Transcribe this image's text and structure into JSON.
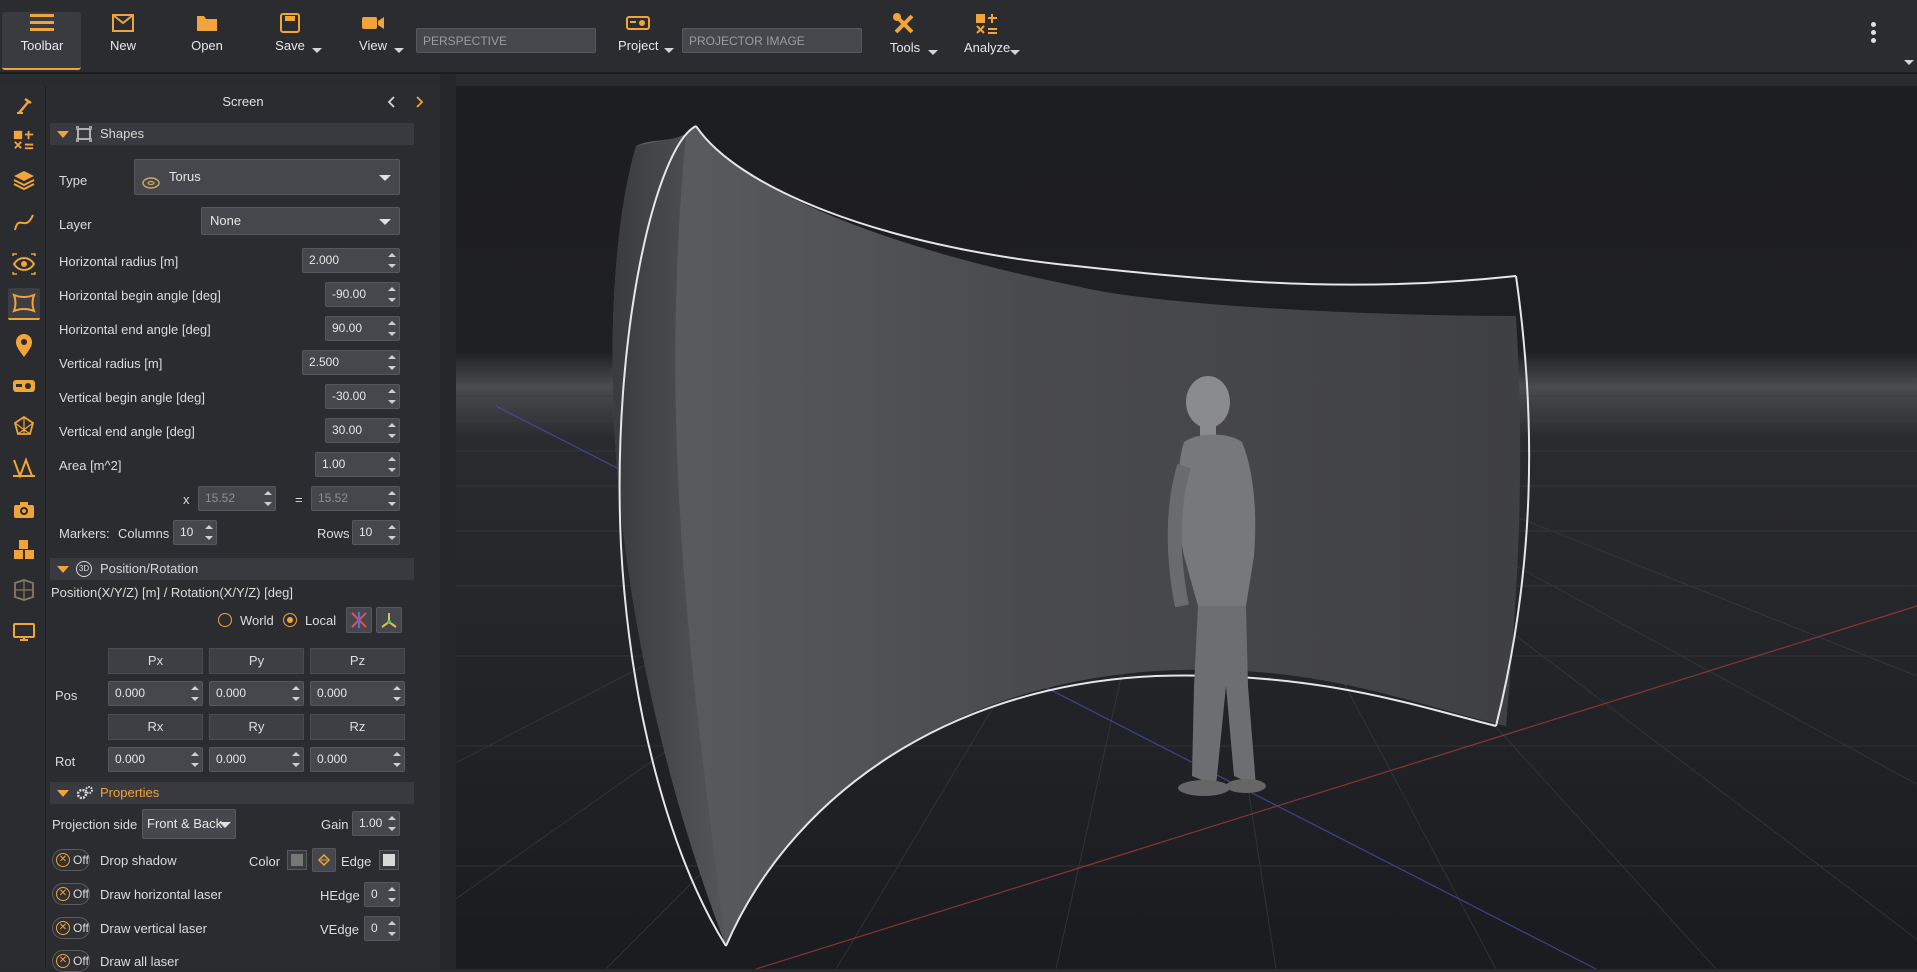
{
  "toolbar": {
    "items": [
      {
        "label": "Toolbar"
      },
      {
        "label": "New"
      },
      {
        "label": "Open"
      },
      {
        "label": "Save"
      },
      {
        "label": "View"
      },
      {
        "label": "Project"
      },
      {
        "label": "Tools"
      },
      {
        "label": "Analyze"
      }
    ],
    "perspective_field": "PERSPECTIVE",
    "projector_field": "PROJECTOR IMAGE"
  },
  "panel": {
    "title": "Screen",
    "shapes": {
      "header": "Shapes",
      "type_label": "Type",
      "type_value": "Torus",
      "layer_label": "Layer",
      "layer_value": "None",
      "fields": [
        {
          "label": "Horizontal radius  [m]",
          "value": "2.000"
        },
        {
          "label": "Horizontal begin angle [deg]",
          "value": "-90.00"
        },
        {
          "label": "Horizontal end angle [deg]",
          "value": "90.00"
        },
        {
          "label": "Vertical radius  [m]",
          "value": "2.500"
        },
        {
          "label": "Vertical begin angle [deg]",
          "value": "-30.00"
        },
        {
          "label": "Vertical end angle [deg]",
          "value": "30.00"
        },
        {
          "label": "Area  [m^2]",
          "value": "1.00"
        }
      ],
      "x_label": "x",
      "eq_label": "=",
      "dim_a": "15.52",
      "dim_b": "15.52",
      "markers_label": "Markers:",
      "columns_label": "Columns",
      "columns_value": "10",
      "rows_label": "Rows",
      "rows_value": "10"
    },
    "position": {
      "header": "Position/Rotation",
      "badge": "3D",
      "caption": "Position(X/Y/Z) [m] / Rotation(X/Y/Z) [deg]",
      "world_label": "World",
      "local_label": "Local",
      "pos_heads": [
        "Px",
        "Py",
        "Pz"
      ],
      "rot_heads": [
        "Rx",
        "Ry",
        "Rz"
      ],
      "pos_label": "Pos",
      "rot_label": "Rot",
      "pos_values": [
        "0.000",
        "0.000",
        "0.000"
      ],
      "rot_values": [
        "0.000",
        "0.000",
        "0.000"
      ]
    },
    "properties": {
      "header": "Properties",
      "projection_label": "Projection side",
      "projection_value": "Front & Back",
      "gain_label": "Gain",
      "gain_value": "1.00",
      "color_label": "Color",
      "edge_label": "Edge",
      "hedge_label": "HEdge",
      "hedge_value": "0",
      "vedge_label": "VEdge",
      "vedge_value": "0",
      "toggles": [
        {
          "state": "Off",
          "label": "Drop shadow"
        },
        {
          "state": "Off",
          "label": "Draw horizontal laser"
        },
        {
          "state": "Off",
          "label": "Draw vertical laser"
        },
        {
          "state": "Off",
          "label": "Draw all laser"
        }
      ]
    }
  },
  "colors": {
    "accent": "#f0a43a",
    "panel_bg": "#2b2c30",
    "viewport_bg": "#1e1f22"
  }
}
